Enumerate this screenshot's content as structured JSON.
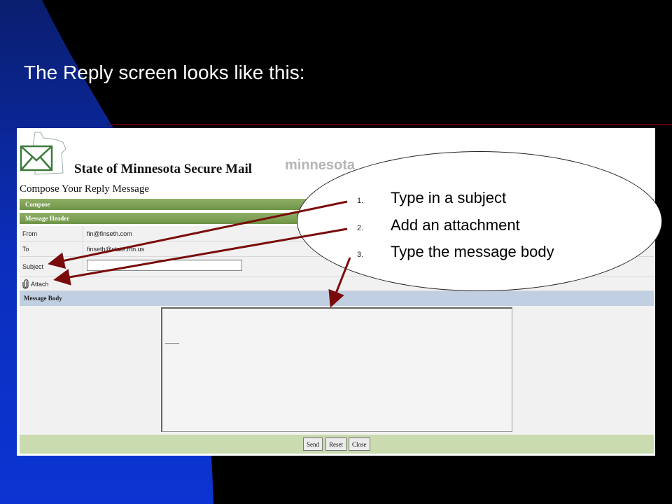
{
  "slide": {
    "title": "The Reply screen looks like this:"
  },
  "app": {
    "brand_name": "State of Minnesota Secure Mail",
    "brand_mark": "minnesota",
    "compose_title": "Compose Your Reply Message"
  },
  "sections": {
    "compose": "Compose",
    "message_header": "Message Header",
    "message_body": "Message Body"
  },
  "fields": {
    "from_label": "From",
    "from_value": "fin@finseth.com",
    "to_label": "To",
    "to_value": "finseth@state.mn.us",
    "subject_label": "Subject",
    "subject_value": ""
  },
  "attach": {
    "label": "Attach",
    "icon": "paperclip-icon"
  },
  "body": {
    "value": "____"
  },
  "buttons": {
    "send": "Send",
    "reset": "Reset",
    "close": "Close"
  },
  "callout": {
    "steps": [
      {
        "number": "1.",
        "text": "Type in a subject"
      },
      {
        "number": "2.",
        "text": "Add an attachment"
      },
      {
        "number": "3.",
        "text": "Type the message body"
      }
    ]
  },
  "colors": {
    "slide_bg": "#000000",
    "slide_blue": "#0b32c8",
    "header_green": "#7a9d52",
    "footer_green": "#cadbb0",
    "body_bar_blue": "#c1cfe3",
    "arrow": "#7a0b0b"
  }
}
